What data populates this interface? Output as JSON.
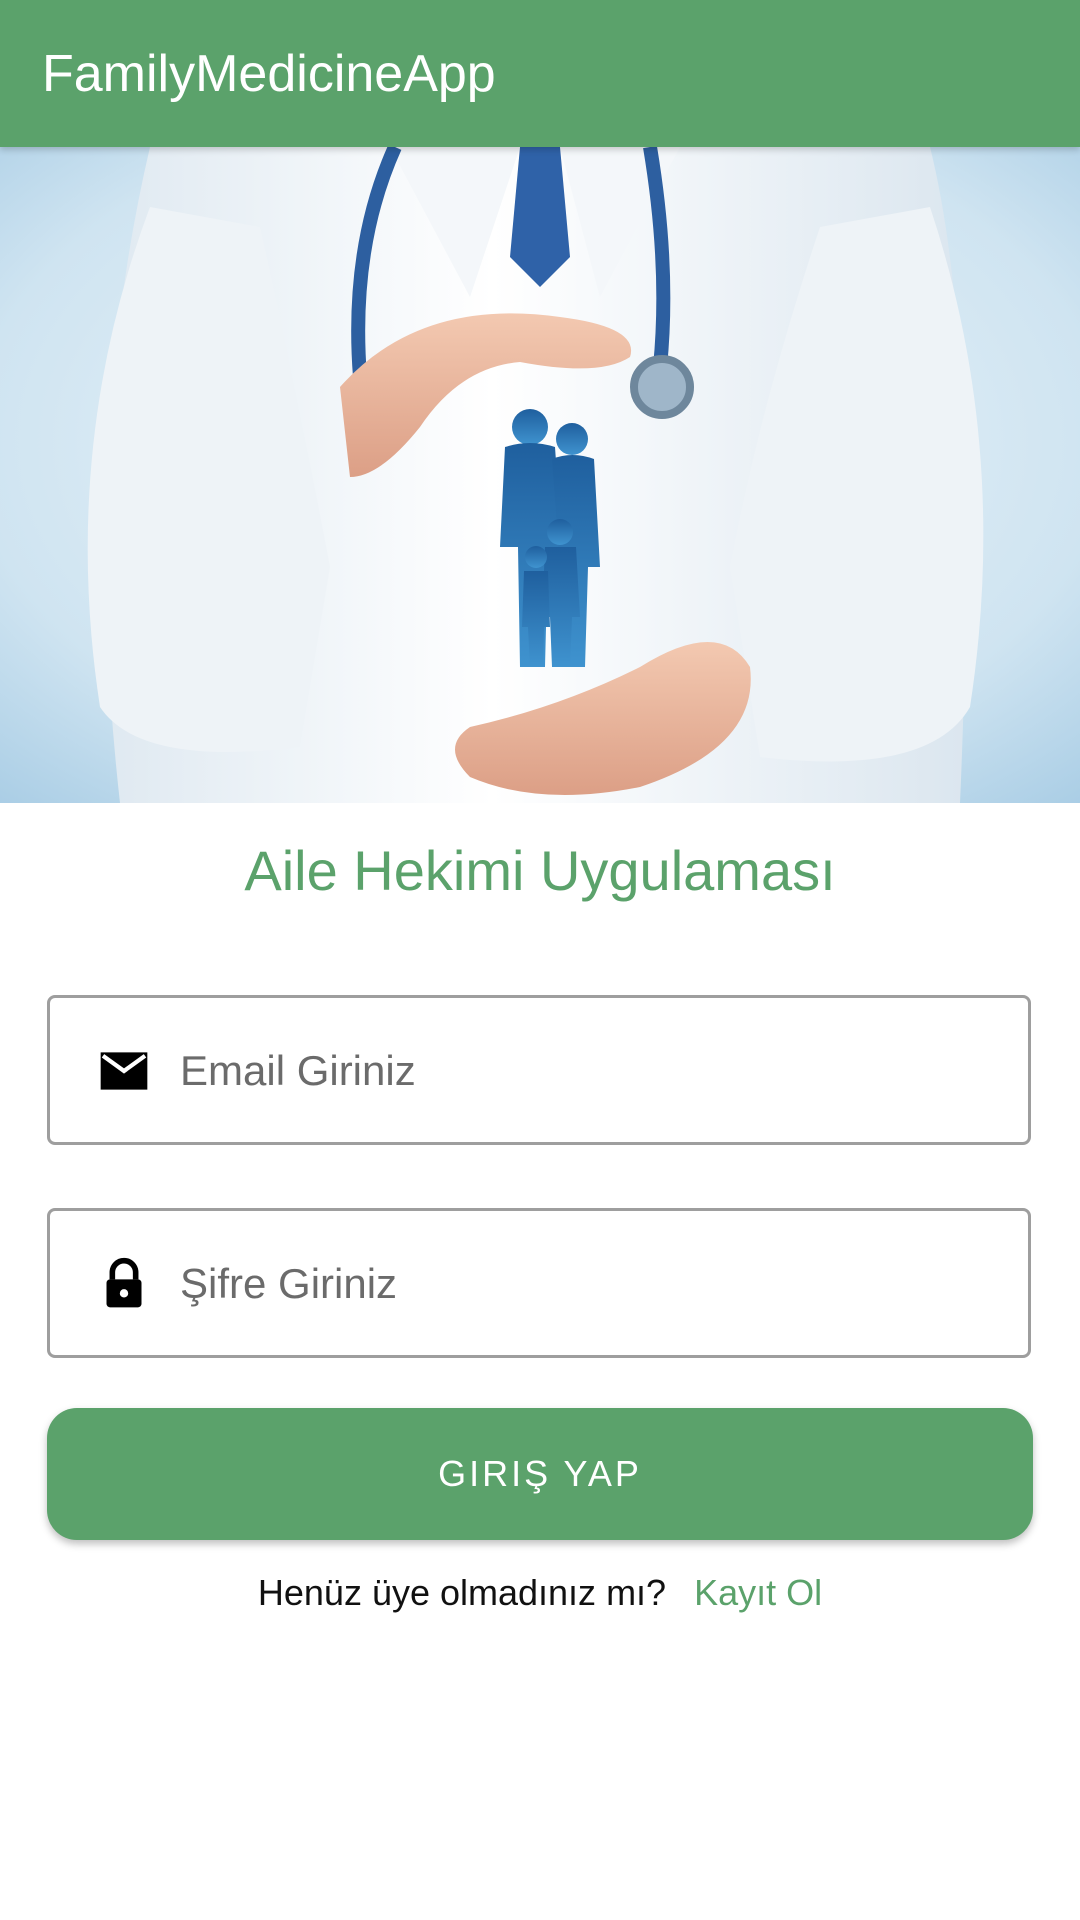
{
  "app_bar": {
    "title": "FamilyMedicineApp"
  },
  "hero": {
    "description_icon": "doctor-family-care-image"
  },
  "main": {
    "heading": "Aile Hekimi Uygulaması",
    "email_field": {
      "placeholder": "Email Giriniz",
      "value": "",
      "icon": "mail-icon"
    },
    "password_field": {
      "placeholder": "Şifre Giriniz",
      "value": "",
      "icon": "lock-icon"
    },
    "login_button": "GIRIŞ YAP",
    "signup_prompt": "Henüz üye olmadınız mı?",
    "signup_link": "Kayıt Ol"
  },
  "colors": {
    "primary": "#5ba26b",
    "field_border": "#9e9e9e",
    "placeholder": "#6b6b6b"
  }
}
